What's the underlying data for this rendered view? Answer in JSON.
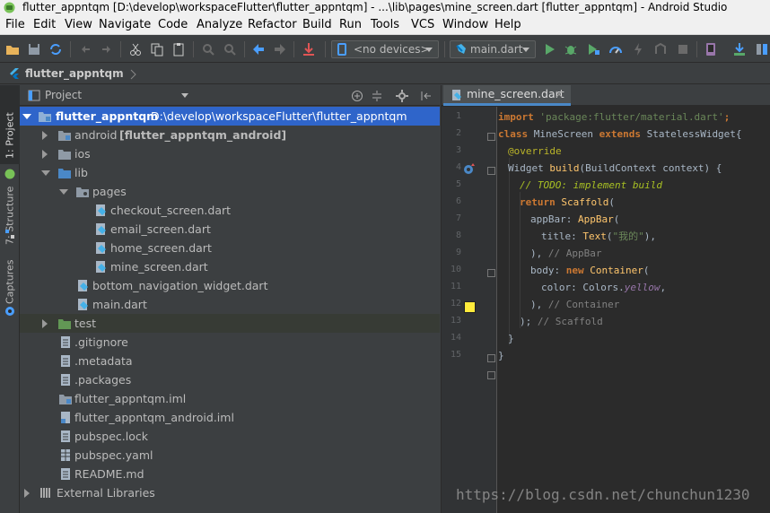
{
  "window": {
    "title": "flutter_appntqm [D:\\develop\\workspaceFlutter\\flutter_appntqm] - ...\\lib\\pages\\mine_screen.dart [flutter_appntqm] - Android Studio"
  },
  "menu": [
    "File",
    "Edit",
    "View",
    "Navigate",
    "Code",
    "Analyze",
    "Refactor",
    "Build",
    "Run",
    "Tools",
    "VCS",
    "Window",
    "Help"
  ],
  "toolbar": {
    "devices_label": "<no devices>",
    "run_config_label": "main.dart"
  },
  "breadcrumb": {
    "project": "flutter_appntqm"
  },
  "side_tabs": {
    "project": "1: Project",
    "structure": "7: Structure",
    "captures": "Captures"
  },
  "project_panel": {
    "view_label": "Project",
    "tree": [
      {
        "name": "flutter_appntqm",
        "path": "D:\\develop\\workspaceFlutter\\flutter_appntqm"
      },
      {
        "name": "android",
        "suffix": "[flutter_appntqm_android]"
      },
      {
        "name": "ios"
      },
      {
        "name": "lib"
      },
      {
        "name": "pages"
      },
      {
        "name": "checkout_screen.dart"
      },
      {
        "name": "email_screen.dart"
      },
      {
        "name": "home_screen.dart"
      },
      {
        "name": "mine_screen.dart"
      },
      {
        "name": "bottom_navigation_widget.dart"
      },
      {
        "name": "main.dart"
      },
      {
        "name": "test"
      },
      {
        "name": ".gitignore"
      },
      {
        "name": ".metadata"
      },
      {
        "name": ".packages"
      },
      {
        "name": "flutter_appntqm.iml"
      },
      {
        "name": "flutter_appntqm_android.iml"
      },
      {
        "name": "pubspec.lock"
      },
      {
        "name": "pubspec.yaml"
      },
      {
        "name": "README.md"
      },
      {
        "name": "External Libraries"
      }
    ]
  },
  "editor": {
    "tab_label": "mine_screen.dart",
    "close_glyph": "×",
    "line_numbers": [
      "1",
      "2",
      "3",
      "4",
      "5",
      "6",
      "7",
      "8",
      "9",
      "10",
      "11",
      "12",
      "13",
      "14",
      "15"
    ],
    "code": {
      "l1_import": "import",
      "l1_pkg": "'package:flutter/material.dart'",
      "l1_semi": ";",
      "l2_class": "class",
      "l2_name": " MineScreen ",
      "l2_extends": "extends",
      "l2_rest": " StatelessWidget{",
      "l3_override": "@override",
      "l4_widget": "Widget ",
      "l4_build": "build",
      "l4_rest": "(BuildContext context) {",
      "l5_todo": "// TODO: implement build",
      "l6_return": "return ",
      "l6_scaffold": "Scaffold",
      "l6_paren": "(",
      "l7_appbar_key": "appBar: ",
      "l7_appbar": "AppBar",
      "l7_paren": "(",
      "l8_title_key": "title: ",
      "l8_text": "Text",
      "l8_open": "(",
      "l8_str": "\"我的\"",
      "l8_close": "),",
      "l9_close": "), ",
      "l9_cmt": "// AppBar",
      "l10_body_key": "body: ",
      "l10_new": "new ",
      "l10_container": "Container",
      "l10_paren": "(",
      "l11_color_key": "color: ",
      "l11_colors": "Colors.",
      "l11_yellow": "yellow",
      "l11_comma": ",",
      "l12_close": "), ",
      "l12_cmt": "// Container",
      "l13_close": "); ",
      "l13_cmt": "// Scaffold",
      "l14_brace": "}",
      "l15_brace": "}"
    }
  },
  "watermark": "https://blog.csdn.net/chunchun1230",
  "colors": {
    "accent": "#2f65ca",
    "swatch_yellow": "#ffeb3b"
  }
}
